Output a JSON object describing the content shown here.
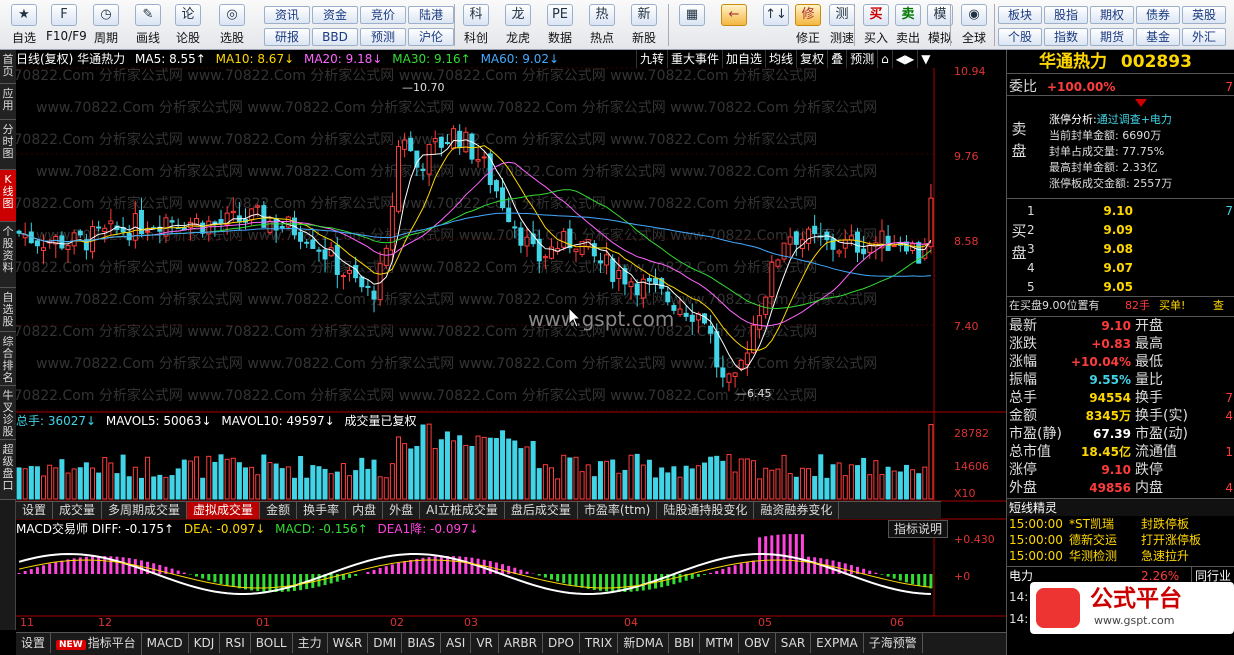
{
  "toolbar": {
    "buttons": [
      {
        "label": "自选",
        "icon": "★"
      },
      {
        "label": "F10/F9",
        "icon": "F"
      },
      {
        "label": "周期",
        "icon": "◷"
      },
      {
        "label": "画线",
        "icon": "✎"
      },
      {
        "label": "论股",
        "icon": "论"
      },
      {
        "label": "选股",
        "icon": "◎"
      },
      {
        "label": "科创",
        "icon": "科"
      },
      {
        "label": "龙虎",
        "icon": "龙"
      },
      {
        "label": "数据",
        "icon": "PE"
      },
      {
        "label": "热点",
        "icon": "热"
      },
      {
        "label": "新股",
        "icon": "新"
      },
      {
        "label": "",
        "icon": "▦"
      },
      {
        "label": "",
        "icon": "←"
      },
      {
        "label": "",
        "icon": "↑↓"
      },
      {
        "label": "修正",
        "icon": "修"
      },
      {
        "label": "测速",
        "icon": "测"
      },
      {
        "label": "买入",
        "icon": "买"
      },
      {
        "label": "卖出",
        "icon": "卖"
      },
      {
        "label": "模拟",
        "icon": "模"
      },
      {
        "label": "全球",
        "icon": "◉"
      }
    ],
    "small_left": [
      "资讯",
      "资金",
      "竞价",
      "陆港",
      "研报",
      "BBD",
      "预测",
      "沪伦"
    ],
    "small_right": [
      "板块",
      "股指",
      "期权",
      "债券",
      "英股",
      "个股",
      "指数",
      "期货",
      "基金",
      "外汇"
    ]
  },
  "left_nav": [
    "首页",
    "应用",
    "分时图",
    "K线图",
    "个股资料",
    "自选股",
    "综合排名",
    "牛叉诊股",
    "超级盘口"
  ],
  "main": {
    "title": "日线(复权) 华通热力",
    "ma": [
      "MA5: 8.55↑",
      "MA10: 8.67↓",
      "MA20: 9.18↓",
      "MA30: 9.16↑",
      "MA60: 9.02↓"
    ],
    "ma_colors": [
      "#ffffff",
      "#ffd700",
      "#ff66ff",
      "#33dd33",
      "#44aaff"
    ],
    "tools": [
      "九转",
      "重大事件",
      "加自选",
      "均线",
      "复权",
      "叠",
      "预测",
      "⌂",
      "◀▶",
      "▼"
    ],
    "price_ticks": [
      "10.94",
      "9.76",
      "8.58",
      "7.40"
    ],
    "high_label": "10.70",
    "low_label": "6.45",
    "center_watermark": "www.gspt.com",
    "bg_watermark": "www.70822.Com 分析家公式网"
  },
  "volume": {
    "bar": [
      "总手: 36027↓",
      "MAVOL5: 50063↓",
      "MAVOL10: 49597↓",
      "成交量已复权"
    ],
    "ticks": [
      "28782",
      "14606",
      "X10"
    ],
    "tabs": [
      "设置",
      "成交量",
      "多周期成交量",
      "虚拟成交量",
      "金额",
      "换手率",
      "内盘",
      "外盘",
      "AI立桩成交量",
      "盘后成交量",
      "市盈率(ttm)",
      "陆股通持股变化",
      "融资融券变化"
    ]
  },
  "macd": {
    "bar": [
      "MACD交易师 DIFF: -0.175↑",
      "DEA: -0.097↓",
      "MACD: -0.156↑",
      "DEA1降: -0.097↓"
    ],
    "ticks": [
      "+0.430",
      "+0"
    ],
    "explain": "指标说明"
  },
  "months": [
    "11",
    "12",
    "01",
    "02",
    "03",
    "04",
    "05",
    "06"
  ],
  "bottom_tabs": [
    "设置",
    "指标平台",
    "MACD",
    "KDJ",
    "RSI",
    "BOLL",
    "主力",
    "W&R",
    "DMI",
    "BIAS",
    "ASI",
    "VR",
    "ARBR",
    "DPO",
    "TRIX",
    "新DMA",
    "BBI",
    "MTM",
    "OBV",
    "SAR",
    "EXPMA",
    "子海预警"
  ],
  "new_badge": "NEW",
  "right": {
    "stock_name": "华通热力",
    "stock_code": "002893",
    "weibi_label": "委比",
    "weibi": "+100.00%",
    "weibi_extra": "7",
    "sell_label": "卖盘",
    "buy_label": "买盘",
    "zt_title": "涨停分析:",
    "zt_reason": "通过调查+电力",
    "zt_lines": [
      "当前封单金额: 6690万",
      "封单占成交量: 77.75%",
      "最高封单金额: 2.33亿",
      "涨停板成交金额: 2557万"
    ],
    "bids": [
      {
        "n": "1",
        "p": "9.10",
        "v": "7"
      },
      {
        "n": "2",
        "p": "9.09",
        "v": ""
      },
      {
        "n": "3",
        "p": "9.08",
        "v": ""
      },
      {
        "n": "4",
        "p": "9.07",
        "v": ""
      },
      {
        "n": "5",
        "p": "9.05",
        "v": ""
      }
    ],
    "buy_note": "在买盘9.00位置有",
    "buy_note_vol": "82手",
    "buy_single": "买单!",
    "buy_more": "查",
    "quote": [
      {
        "l": "最新",
        "v": "9.10",
        "l2": "开盘",
        "c": "red"
      },
      {
        "l": "涨跌",
        "v": "+0.83",
        "l2": "最高",
        "c": "red"
      },
      {
        "l": "涨幅",
        "v": "+10.04%",
        "l2": "最低",
        "c": "red"
      },
      {
        "l": "振幅",
        "v": "9.55%",
        "l2": "量比",
        "c": "cyn"
      },
      {
        "l": "总手",
        "v": "94554",
        "l2": "换手",
        "c": "yel"
      },
      {
        "l": "金额",
        "v": "8345万",
        "l2": "换手(实)",
        "c": "yel"
      },
      {
        "l": "市盈(静)",
        "v": "67.39",
        "l2": "市盈(动)",
        "c": "wht"
      },
      {
        "l": "总市值",
        "v": "18.45亿",
        "l2": "流通值",
        "c": "yel"
      },
      {
        "l": "涨停",
        "v": "9.10",
        "l2": "跌停",
        "c": "red"
      },
      {
        "l": "外盘",
        "v": "49856",
        "l2": "内盘",
        "c": "red"
      }
    ],
    "quote_extra": [
      "",
      "",
      "",
      "",
      "7",
      "4",
      "",
      "1",
      "",
      "4"
    ],
    "short_title": "短线精灵",
    "short_list": [
      {
        "t": "15:00:00",
        "n": "*ST凯瑞",
        "e": "封跌停板"
      },
      {
        "t": "15:00:00",
        "n": "德新交运",
        "e": "打开涨停板"
      },
      {
        "t": "15:00:00",
        "n": "华测检测",
        "e": "急速拉升"
      }
    ],
    "sector": "电力",
    "sector_pct": "2.26%",
    "sector_btn": "同行业",
    "bottom_times": [
      "14:",
      "14:"
    ]
  },
  "watermark": {
    "title": "公式平台",
    "url": "www.gspt.com"
  },
  "colors": {
    "up": "#ff3c3c",
    "down": "#41d4e6",
    "macd_pos": "#ff44dd",
    "macd_neg": "#33dd33"
  }
}
